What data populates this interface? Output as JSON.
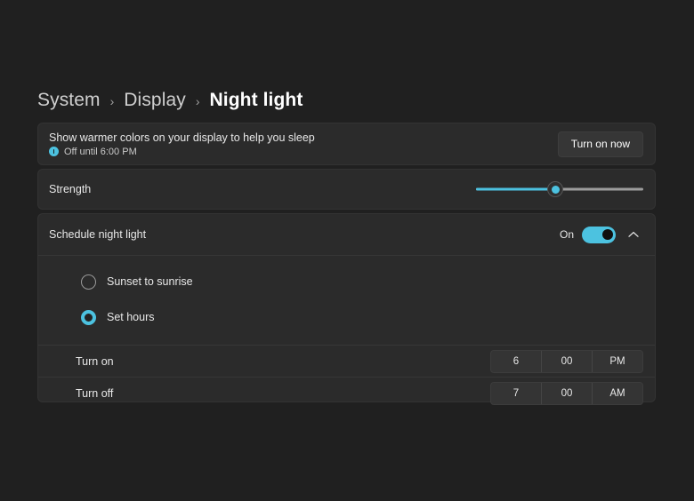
{
  "breadcrumb": {
    "separator": "›",
    "items": [
      {
        "label": "System"
      },
      {
        "label": "Display"
      },
      {
        "label": "Night light"
      }
    ]
  },
  "main_card": {
    "title": "Show warmer colors on your display to help you sleep",
    "status_icon": "info-circle-icon",
    "status": "Off until 6:00 PM",
    "button_label": "Turn on now"
  },
  "strength": {
    "label": "Strength",
    "value_percent": 47
  },
  "schedule": {
    "label": "Schedule night light",
    "toggle_state": "On",
    "expander_icon": "chevron-up-icon",
    "options": [
      {
        "label": "Sunset to sunrise",
        "selected": false
      },
      {
        "label": "Set hours",
        "selected": true
      }
    ],
    "times": [
      {
        "label": "Turn on",
        "hour": "6",
        "minute": "00",
        "period": "PM"
      },
      {
        "label": "Turn off",
        "hour": "7",
        "minute": "00",
        "period": "AM"
      }
    ]
  },
  "colors": {
    "accent": "#4cc2e0",
    "page_background": "#202020",
    "card_background": "#2b2b2b"
  }
}
